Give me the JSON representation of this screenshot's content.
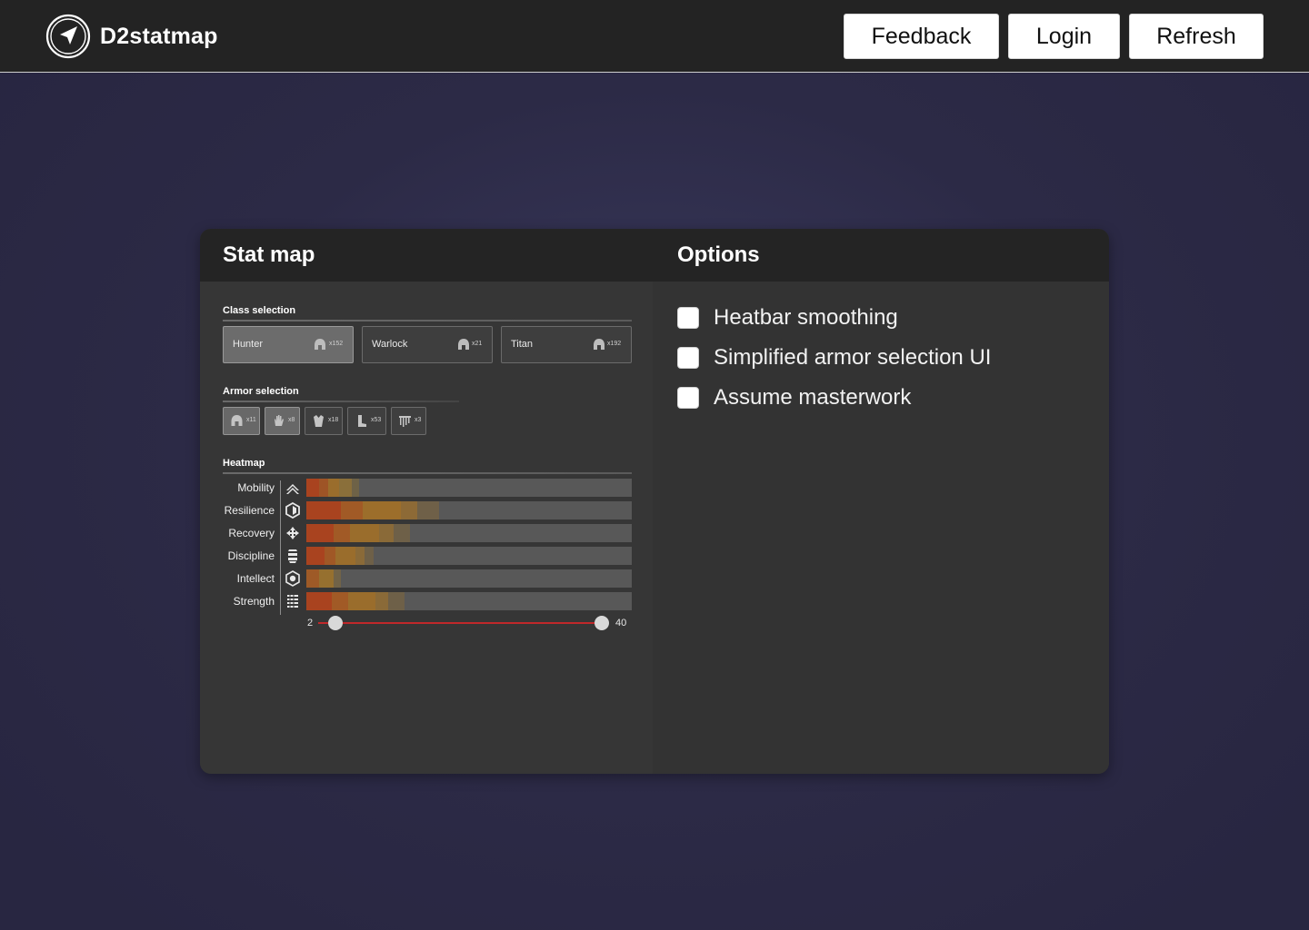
{
  "header": {
    "brand": "D2statmap",
    "buttons": {
      "feedback": "Feedback",
      "login": "Login",
      "refresh": "Refresh"
    }
  },
  "stat_map": {
    "title": "Stat map",
    "class_section_label": "Class selection",
    "classes": [
      {
        "name": "Hunter",
        "count": "x152",
        "selected": true,
        "icon": "helmet-icon"
      },
      {
        "name": "Warlock",
        "count": "x21",
        "selected": false,
        "icon": "helmet-icon"
      },
      {
        "name": "Titan",
        "count": "x192",
        "selected": false,
        "icon": "helmet-icon"
      }
    ],
    "armor_section_label": "Armor selection",
    "armor": [
      {
        "slot": "helmet",
        "count": "x11",
        "selected": true,
        "icon": "helmet-icon"
      },
      {
        "slot": "gauntlets",
        "count": "x8",
        "selected": true,
        "icon": "gauntlets-icon"
      },
      {
        "slot": "chest",
        "count": "x18",
        "selected": false,
        "icon": "chest-armor-icon"
      },
      {
        "slot": "legs",
        "count": "x53",
        "selected": false,
        "icon": "leg-armor-icon"
      },
      {
        "slot": "class-item",
        "count": "x3",
        "selected": false,
        "icon": "cloak-icon"
      }
    ],
    "heatmap_section_label": "Heatmap",
    "stats": [
      {
        "name": "Mobility",
        "icon": "mobility-icon"
      },
      {
        "name": "Resilience",
        "icon": "resilience-icon"
      },
      {
        "name": "Recovery",
        "icon": "recovery-icon"
      },
      {
        "name": "Discipline",
        "icon": "discipline-icon"
      },
      {
        "name": "Intellect",
        "icon": "intellect-icon"
      },
      {
        "name": "Strength",
        "icon": "strength-icon"
      }
    ],
    "range": {
      "min": "2",
      "max": "40"
    },
    "colors": {
      "accent": "#c0282a",
      "heat_hot": "#a8401f",
      "heat_warm": "#9b6a2a"
    }
  },
  "options": {
    "title": "Options",
    "items": [
      {
        "label": "Heatbar smoothing",
        "checked": false
      },
      {
        "label": "Simplified armor selection UI",
        "checked": false
      },
      {
        "label": "Assume masterwork",
        "checked": false
      }
    ]
  }
}
